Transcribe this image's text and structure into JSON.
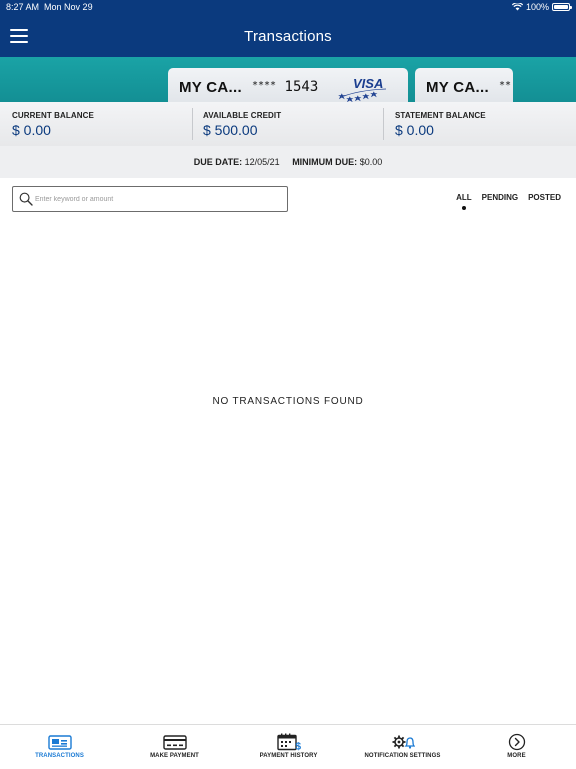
{
  "status": {
    "time": "8:27 AM",
    "date": "Mon Nov 29",
    "battery": "100%"
  },
  "header": {
    "title": "Transactions",
    "menu_icon": "hamburger-icon"
  },
  "cards": [
    {
      "name": "MY CA...",
      "masked_prefix": "****",
      "last4": "1543",
      "brand": "VISA"
    },
    {
      "name": "MY CA...",
      "masked_prefix": "**"
    }
  ],
  "balances": [
    {
      "label": "CURRENT BALANCE",
      "value": "$ 0.00"
    },
    {
      "label": "AVAILABLE CREDIT",
      "value": "$ 500.00"
    },
    {
      "label": "STATEMENT BALANCE",
      "value": "$ 0.00"
    }
  ],
  "due": {
    "due_label": "DUE DATE:",
    "due_value": "12/05/21",
    "min_label": "MINIMUM DUE:",
    "min_value": "$0.00"
  },
  "search": {
    "placeholder": "Enter keyword or amount",
    "value": ""
  },
  "filters": {
    "tabs": [
      "ALL",
      "PENDING",
      "POSTED"
    ],
    "selected": "ALL"
  },
  "empty_message": "NO TRANSACTIONS FOUND",
  "tabbar": {
    "items": [
      {
        "label": "TRANSACTIONS",
        "icon": "transactions-icon",
        "active": true
      },
      {
        "label": "MAKE PAYMENT",
        "icon": "card-payment-icon",
        "active": false
      },
      {
        "label": "PAYMENT HISTORY",
        "icon": "calendar-dollar-icon",
        "active": false
      },
      {
        "label": "NOTIFICATION SETTINGS",
        "icon": "gear-bell-icon",
        "active": false
      },
      {
        "label": "MORE",
        "icon": "chevron-right-circle-icon",
        "active": false
      }
    ]
  },
  "colors": {
    "header": "#0b3a7e",
    "card_strip": "#1aa3a6",
    "accent": "#1a7ad4"
  }
}
